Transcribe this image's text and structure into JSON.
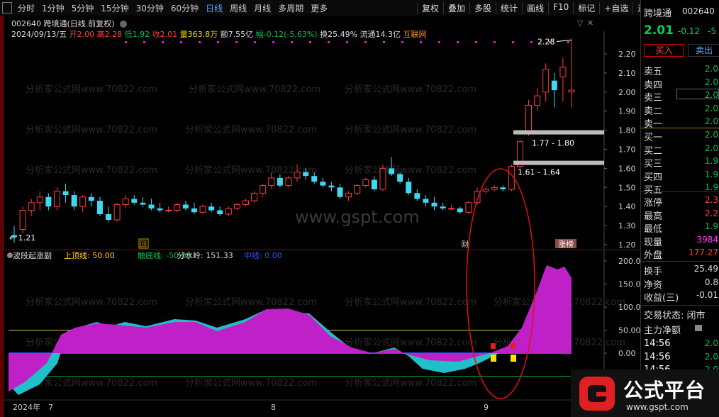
{
  "toolbar": {
    "left_tabs": [
      "分时",
      "1分钟",
      "5分钟",
      "15分钟",
      "30分钟",
      "60分钟",
      "日线",
      "周线",
      "月线",
      "多周期",
      "更多"
    ],
    "active_tab": "日线",
    "right_tabs": [
      "复权",
      "叠加",
      "多股",
      "统计",
      "画线",
      "F10",
      "标记",
      "+自选",
      "返回"
    ]
  },
  "stock": {
    "code": "002640",
    "name": "跨境通",
    "title": "002640 跨境通(日线 前复权)",
    "date": "2024/09/13/五",
    "open": "开2.00",
    "high": "高2.28",
    "low": "低1.92",
    "close": "收2.01",
    "volume": "量363.8万",
    "amount": "额7.55亿",
    "change": "幅-0.12(-5.63%)",
    "turnover": "换25.49%",
    "float": "流通14.3亿",
    "sector": "互联网"
  },
  "price_axis": [
    "2.20",
    "2.10",
    "2.00",
    "1.90",
    "1.80",
    "1.70",
    "1.60",
    "1.50",
    "1.40",
    "1.30",
    "1.20"
  ],
  "annotations": {
    "high_label": "2.28",
    "low_label": "1.21",
    "zone1": "1.77 - 1.80",
    "zone2": "1.61 - 1.64",
    "watermark": "www.gspt.com",
    "bg_watermark": "分析家公式网www.70822.com",
    "marker_hui": "回",
    "marker_cai": "财",
    "marker_zhangbang": "涨榜"
  },
  "indicator": {
    "name": "波段起涨副",
    "upper": "上顶线: 50.00",
    "lower": "触底线: -50.00",
    "water": "分水岭: 151.33",
    "mid": "中线: 0.00",
    "axis": [
      "200.0",
      "150.0",
      "100.0",
      "50.00",
      "0.00"
    ]
  },
  "dates": {
    "year": "2024年",
    "m7": "7",
    "m8": "8",
    "m9": "9"
  },
  "side": {
    "title": "跨境通",
    "code": "002640",
    "price": "2.01",
    "change": "-0.12",
    "pct": "-5",
    "buy_btn": "买入",
    "sell_btn": "卖出",
    "asks": [
      {
        "k": "卖五",
        "v": "2.0"
      },
      {
        "k": "卖四",
        "v": "2.0"
      },
      {
        "k": "卖三",
        "v": "2.0"
      },
      {
        "k": "卖二",
        "v": "2.0"
      },
      {
        "k": "卖一",
        "v": "2.0"
      }
    ],
    "bids": [
      {
        "k": "买一",
        "v": "2.0"
      },
      {
        "k": "买二",
        "v": "2.0"
      },
      {
        "k": "买三",
        "v": "1.9"
      },
      {
        "k": "买四",
        "v": "1.9"
      },
      {
        "k": "买五",
        "v": "1.9"
      }
    ],
    "stats": [
      {
        "k": "涨停",
        "v": "2.3"
      },
      {
        "k": "最高",
        "v": "2.2"
      },
      {
        "k": "最低",
        "v": "1.9"
      },
      {
        "k": "现量",
        "v": "3984"
      },
      {
        "k": "外盘",
        "v": "177.27"
      }
    ],
    "stats2": [
      {
        "k": "换手",
        "v": "25.49"
      },
      {
        "k": "净资",
        "v": "0.8"
      },
      {
        "k": "收益(三)",
        "v": "-0.01"
      }
    ],
    "trade_state": "交易状态: 闭市",
    "main_flow": "主力净额",
    "ticks": [
      {
        "t": "14:56",
        "v": "2.0"
      },
      {
        "t": "14:56",
        "v": "2.0"
      },
      {
        "t": "14:56",
        "v": "2.0"
      }
    ]
  },
  "logo_text": "公式平台",
  "logo_url": "www.gspt.com",
  "chart_data": {
    "type": "candlestick",
    "candles": [
      [
        1.25,
        1.3,
        1.21,
        1.24
      ],
      [
        1.28,
        1.4,
        1.26,
        1.38
      ],
      [
        1.38,
        1.44,
        1.35,
        1.42
      ],
      [
        1.42,
        1.48,
        1.38,
        1.45
      ],
      [
        1.45,
        1.47,
        1.38,
        1.4
      ],
      [
        1.4,
        1.5,
        1.38,
        1.48
      ],
      [
        1.48,
        1.52,
        1.42,
        1.46
      ],
      [
        1.46,
        1.48,
        1.38,
        1.4
      ],
      [
        1.4,
        1.46,
        1.37,
        1.45
      ],
      [
        1.45,
        1.47,
        1.4,
        1.43
      ],
      [
        1.43,
        1.45,
        1.35,
        1.36
      ],
      [
        1.36,
        1.4,
        1.32,
        1.33
      ],
      [
        1.33,
        1.42,
        1.32,
        1.41
      ],
      [
        1.41,
        1.46,
        1.39,
        1.44
      ],
      [
        1.44,
        1.46,
        1.41,
        1.42
      ],
      [
        1.42,
        1.45,
        1.4,
        1.41
      ],
      [
        1.41,
        1.44,
        1.38,
        1.39
      ],
      [
        1.39,
        1.42,
        1.37,
        1.38
      ],
      [
        1.38,
        1.4,
        1.37,
        1.38
      ],
      [
        1.38,
        1.42,
        1.37,
        1.41
      ],
      [
        1.41,
        1.43,
        1.38,
        1.39
      ],
      [
        1.39,
        1.42,
        1.36,
        1.37
      ],
      [
        1.37,
        1.41,
        1.36,
        1.4
      ],
      [
        1.4,
        1.42,
        1.37,
        1.38
      ],
      [
        1.38,
        1.4,
        1.35,
        1.36
      ],
      [
        1.36,
        1.4,
        1.35,
        1.39
      ],
      [
        1.39,
        1.42,
        1.38,
        1.41
      ],
      [
        1.41,
        1.44,
        1.4,
        1.43
      ],
      [
        1.43,
        1.48,
        1.42,
        1.47
      ],
      [
        1.47,
        1.52,
        1.45,
        1.51
      ],
      [
        1.51,
        1.58,
        1.49,
        1.55
      ],
      [
        1.55,
        1.57,
        1.5,
        1.51
      ],
      [
        1.51,
        1.56,
        1.5,
        1.55
      ],
      [
        1.55,
        1.62,
        1.53,
        1.58
      ],
      [
        1.58,
        1.6,
        1.54,
        1.56
      ],
      [
        1.56,
        1.58,
        1.52,
        1.53
      ],
      [
        1.53,
        1.55,
        1.5,
        1.51
      ],
      [
        1.51,
        1.53,
        1.48,
        1.5
      ],
      [
        1.5,
        1.52,
        1.44,
        1.45
      ],
      [
        1.45,
        1.48,
        1.43,
        1.47
      ],
      [
        1.47,
        1.52,
        1.46,
        1.51
      ],
      [
        1.51,
        1.55,
        1.5,
        1.54
      ],
      [
        1.54,
        1.56,
        1.48,
        1.49
      ],
      [
        1.49,
        1.62,
        1.48,
        1.6
      ],
      [
        1.6,
        1.66,
        1.56,
        1.57
      ],
      [
        1.57,
        1.58,
        1.52,
        1.53
      ],
      [
        1.53,
        1.55,
        1.46,
        1.47
      ],
      [
        1.47,
        1.49,
        1.43,
        1.44
      ],
      [
        1.44,
        1.46,
        1.4,
        1.42
      ],
      [
        1.42,
        1.45,
        1.38,
        1.4
      ],
      [
        1.4,
        1.42,
        1.38,
        1.39
      ],
      [
        1.39,
        1.41,
        1.38,
        1.39
      ],
      [
        1.39,
        1.4,
        1.36,
        1.37
      ],
      [
        1.37,
        1.43,
        1.36,
        1.42
      ],
      [
        1.42,
        1.5,
        1.41,
        1.48
      ],
      [
        1.48,
        1.5,
        1.47,
        1.49
      ],
      [
        1.49,
        1.51,
        1.48,
        1.5
      ],
      [
        1.5,
        1.51,
        1.48,
        1.49
      ],
      [
        1.49,
        1.62,
        1.48,
        1.61
      ],
      [
        1.61,
        1.75,
        1.6,
        1.74
      ],
      [
        1.78,
        1.96,
        1.77,
        1.93
      ],
      [
        1.93,
        2.02,
        1.9,
        1.98
      ],
      [
        2.0,
        2.15,
        1.95,
        2.12
      ],
      [
        2.06,
        2.1,
        1.92,
        2.01
      ],
      [
        2.08,
        2.18,
        1.95,
        2.13
      ],
      [
        2.0,
        2.28,
        1.92,
        2.01
      ]
    ]
  }
}
